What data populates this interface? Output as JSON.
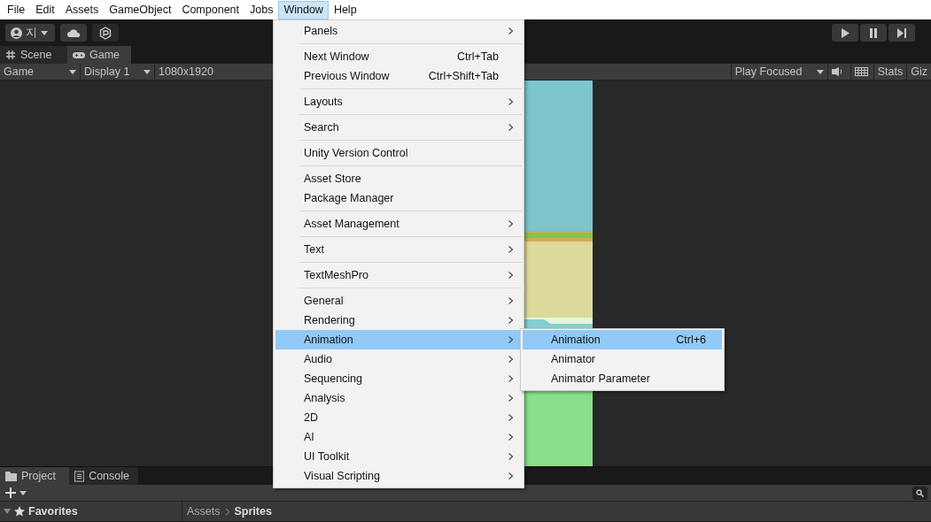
{
  "menu_bar": [
    {
      "label": "File",
      "selected": false
    },
    {
      "label": "Edit",
      "selected": false
    },
    {
      "label": "Assets",
      "selected": false
    },
    {
      "label": "GameObject",
      "selected": false
    },
    {
      "label": "Component",
      "selected": false
    },
    {
      "label": "Jobs",
      "selected": false
    },
    {
      "label": "Window",
      "selected": true
    },
    {
      "label": "Help",
      "selected": false
    }
  ],
  "toolbar": {
    "account": "지"
  },
  "view_tabs": [
    {
      "label": "Scene",
      "kind": "scene",
      "selected": false
    },
    {
      "label": "Game",
      "kind": "game",
      "selected": true
    }
  ],
  "game_toolbar": {
    "view": "Game",
    "display": "Display 1",
    "resolution": "1080x1920",
    "play_mode": "Play Focused",
    "stats": "Stats",
    "gizmos": "Giz"
  },
  "window_menu": {
    "groups": [
      [
        {
          "label": "Panels",
          "has_submenu": true,
          "selected": false
        }
      ],
      [
        {
          "label": "Next Window",
          "shortcut": "Ctrl+Tab",
          "has_submenu": false,
          "selected": false
        },
        {
          "label": "Previous Window",
          "shortcut": "Ctrl+Shift+Tab",
          "has_submenu": false,
          "selected": false
        }
      ],
      [
        {
          "label": "Layouts",
          "has_submenu": true,
          "selected": false
        }
      ],
      [
        {
          "label": "Search",
          "has_submenu": true,
          "selected": false
        }
      ],
      [
        {
          "label": "Unity Version Control",
          "has_submenu": false,
          "selected": false
        }
      ],
      [
        {
          "label": "Asset Store",
          "has_submenu": false,
          "selected": false
        },
        {
          "label": "Package Manager",
          "has_submenu": false,
          "selected": false
        }
      ],
      [
        {
          "label": "Asset Management",
          "has_submenu": true,
          "selected": false
        }
      ],
      [
        {
          "label": "Text",
          "has_submenu": true,
          "selected": false
        }
      ],
      [
        {
          "label": "TextMeshPro",
          "has_submenu": true,
          "selected": false
        }
      ],
      [
        {
          "label": "General",
          "has_submenu": true,
          "selected": false
        },
        {
          "label": "Rendering",
          "has_submenu": true,
          "selected": false
        },
        {
          "label": "Animation",
          "has_submenu": true,
          "selected": true
        },
        {
          "label": "Audio",
          "has_submenu": true,
          "selected": false
        },
        {
          "label": "Sequencing",
          "has_submenu": true,
          "selected": false
        },
        {
          "label": "Analysis",
          "has_submenu": true,
          "selected": false
        },
        {
          "label": "2D",
          "has_submenu": true,
          "selected": false
        },
        {
          "label": "AI",
          "has_submenu": true,
          "selected": false
        },
        {
          "label": "UI Toolkit",
          "has_submenu": true,
          "selected": false
        },
        {
          "label": "Visual Scripting",
          "has_submenu": true,
          "selected": false
        }
      ]
    ]
  },
  "animation_submenu": [
    {
      "label": "Animation",
      "shortcut": "Ctrl+6",
      "selected": true
    },
    {
      "label": "Animator",
      "selected": false
    },
    {
      "label": "Animator Parameter",
      "selected": false
    }
  ],
  "bottom_tabs": [
    {
      "label": "Project",
      "kind": "project",
      "selected": true
    },
    {
      "label": "Console",
      "kind": "console",
      "selected": false
    }
  ],
  "project": {
    "tree": [
      {
        "label": "Favorites",
        "expanded": true
      }
    ],
    "breadcrumb": [
      "Assets",
      "Sprites"
    ]
  }
}
